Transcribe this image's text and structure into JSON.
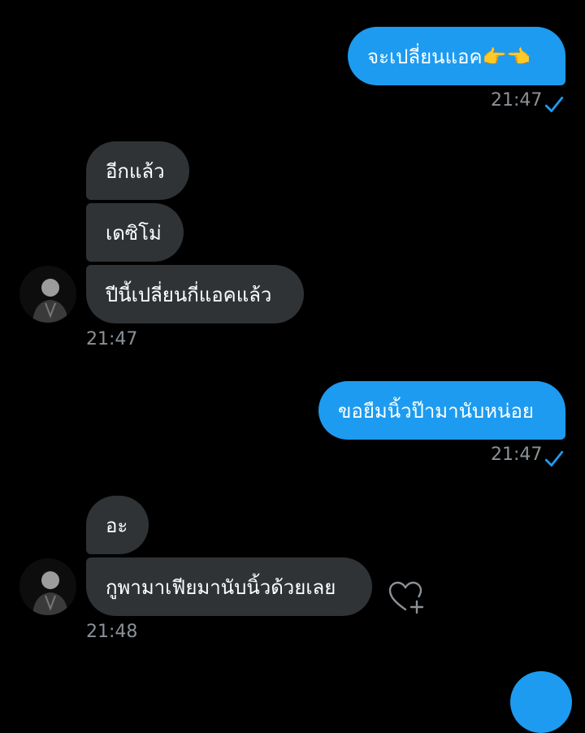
{
  "conversation": {
    "messages": [
      {
        "direction": "outgoing",
        "text": "จะเปลี่ยนแอค👉👈",
        "timestamp": "21:47",
        "read": true
      },
      {
        "direction": "incoming",
        "text": "อีกแล้ว"
      },
      {
        "direction": "incoming",
        "text": "เดซิโม่"
      },
      {
        "direction": "incoming",
        "text": "ปีนี้เปลี่ยนกี่แอคแล้ว",
        "timestamp": "21:47"
      },
      {
        "direction": "outgoing",
        "text": "ขอยืมนิ้วป๊ามานับหน่อย",
        "timestamp": "21:47",
        "read": true
      },
      {
        "direction": "incoming",
        "text": "อะ"
      },
      {
        "direction": "incoming",
        "text": "กูพามาเฟียมานับนิ้วด้วยเลย",
        "timestamp": "21:48"
      }
    ]
  },
  "icons": {
    "read_receipt": "check-icon",
    "react": "heart-plus-icon",
    "avatar": "user-avatar"
  },
  "colors": {
    "background": "#000000",
    "outgoing_bubble": "#1d9bf0",
    "incoming_bubble": "#2f3336",
    "timestamp": "#8b9196",
    "accent": "#1d9bf0"
  }
}
